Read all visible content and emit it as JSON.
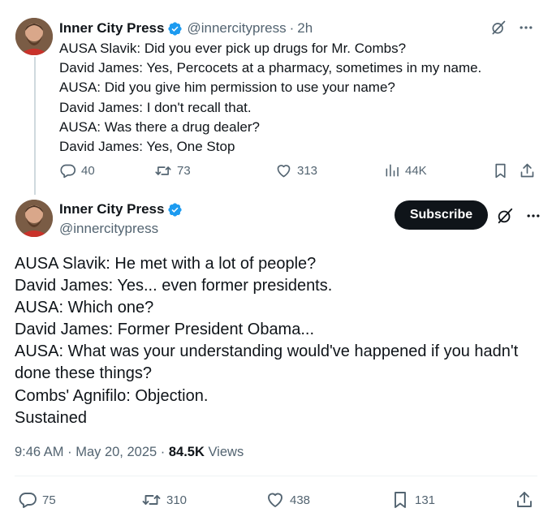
{
  "tweet1": {
    "name": "Inner City Press",
    "handle": "@innercitypress",
    "time": "2h",
    "lines": [
      "AUSA Slavik: Did you ever pick up drugs for Mr. Combs?",
      "David James: Yes, Percocets at a pharmacy, sometimes in my name.",
      "AUSA: Did you give him permission to use your name?",
      "David James: I don't recall that.",
      "AUSA: Was there a drug dealer?",
      "David James: Yes, One Stop"
    ],
    "replies": "40",
    "reposts": "73",
    "likes": "313",
    "views": "44K",
    "icons": [
      "grok-icon",
      "more-icon",
      "reply-icon",
      "repost-icon",
      "like-icon",
      "views-icon",
      "bookmark-icon",
      "share-icon"
    ]
  },
  "tweet2": {
    "name": "Inner City Press",
    "handle": "@innercitypress",
    "subscribe_label": "Subscribe",
    "lines": [
      "AUSA Slavik: He met with a lot of people?",
      "David James: Yes... even former presidents.",
      "AUSA: Which one?",
      "David James: Former President Obama...",
      "AUSA: What was your understanding would've happened if you hadn't",
      "done these things?",
      "Combs' Agnifilo: Objection.",
      "Sustained"
    ],
    "timestamp": "9:46 AM · May 20, 2025 · ",
    "views_count": "84.5K",
    "views_label": " Views",
    "replies": "75",
    "reposts": "310",
    "likes": "438",
    "bookmarks": "131"
  },
  "colors": {
    "text": "#0f1419",
    "secondary": "#536471",
    "verified": "#1d9bf0",
    "button": "#0f1419",
    "thread_line": "#cfd9de"
  }
}
